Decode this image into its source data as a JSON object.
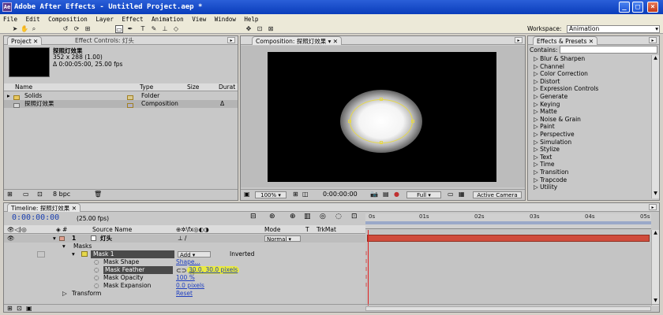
{
  "window": {
    "title": "Adobe After Effects - Untitled Project.aep *",
    "minimize": "_",
    "maximize": "□",
    "close": "×"
  },
  "menu": [
    "File",
    "Edit",
    "Composition",
    "Layer",
    "Effect",
    "Animation",
    "View",
    "Window",
    "Help"
  ],
  "toolbar": {
    "workspace_label": "Workspace:",
    "workspace_value": "Animation",
    "tools": [
      "selection-tool-icon",
      "hand-tool-icon",
      "zoom-tool-icon",
      "rotate-tool-icon",
      "orbit-camera-icon",
      "pan-behind-icon",
      "mask-tool-icon",
      "pen-tool-icon",
      "text-tool-icon",
      "brush-tool-icon",
      "clone-stamp-icon",
      "eraser-icon",
      "axis-local-icon",
      "axis-world-icon",
      "axis-view-icon"
    ]
  },
  "project_panel": {
    "tab_project": "Project",
    "tab_effect_controls": "Effect Controls: 灯头",
    "comp_name": "探照灯效果",
    "comp_size": "352 x 288 (1.00)",
    "comp_duration": "Δ 0:00:05:00, 25.00 fps",
    "columns": [
      "Name",
      "Type",
      "Size",
      "Durat"
    ],
    "items": [
      {
        "name": "Solids",
        "type": "Folder",
        "size": "",
        "dur": ""
      },
      {
        "name": "探照灯效果",
        "type": "Composition",
        "size": "",
        "dur": "Δ"
      }
    ],
    "bpc": "8 bpc"
  },
  "comp_panel": {
    "tab": "Composition: 探照灯效果",
    "zoom": "100%",
    "timecode": "0:00:00:00",
    "resolution": "Full",
    "camera": "Active Camera"
  },
  "effects_panel": {
    "tab": "Effects & Presets",
    "contains_label": "Contains:",
    "items": [
      "Blur & Sharpen",
      "Channel",
      "Color Correction",
      "Distort",
      "Expression Controls",
      "Generate",
      "Keying",
      "Matte",
      "Noise & Grain",
      "Paint",
      "Perspective",
      "Simulation",
      "Stylize",
      "Text",
      "Time",
      "Transition",
      "Trapcode",
      "Utility"
    ]
  },
  "timeline": {
    "tab": "Timeline: 探照灯效果",
    "timecode": "0:00:00:00",
    "fps": "(25.00 fps)",
    "columns": {
      "num": "#",
      "source": "Source Name",
      "mode": "Mode",
      "t": "T",
      "trkmat": "TrkMat"
    },
    "layer": {
      "num": "1",
      "name": "灯头",
      "mode": "Normal"
    },
    "masks_label": "Masks",
    "mask": {
      "name": "Mask 1",
      "mode": "Add",
      "inverted": "Inverted"
    },
    "properties": [
      {
        "name": "Mask Shape",
        "value": "Shape..."
      },
      {
        "name": "Mask Feather",
        "value": "30.0, 30.0 pixels"
      },
      {
        "name": "Mask Opacity",
        "value": "100 %"
      },
      {
        "name": "Mask Expansion",
        "value": "0.0 pixels"
      }
    ],
    "transform": {
      "name": "Transform",
      "value": "Reset"
    },
    "ruler": [
      "0s",
      "01s",
      "02s",
      "03s",
      "04s",
      "05s"
    ]
  },
  "colors": {
    "title_blue": "#0a3dbb",
    "layer_bar": "#d04c3c",
    "time_indicator": "#e02020",
    "timecode_blue": "#1a3fb0",
    "link_blue": "#2040c0",
    "mask_yellow": "#e6d84a"
  }
}
